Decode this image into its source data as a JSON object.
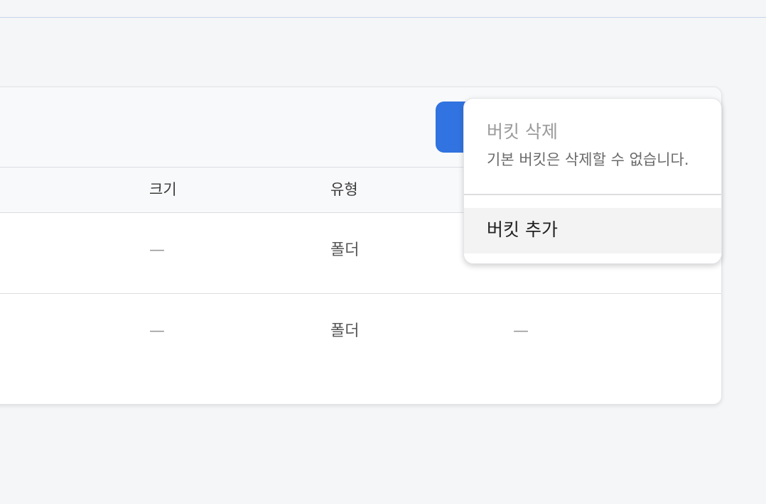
{
  "table": {
    "headers": {
      "size": "크기",
      "type": "유형"
    },
    "rows": [
      {
        "size": "—",
        "type": "폴더",
        "extra": ""
      },
      {
        "size": "—",
        "type": "폴더",
        "extra": "—"
      }
    ]
  },
  "menu": {
    "delete_bucket": {
      "label": "버킷 삭제",
      "hint": "기본 버킷은 삭제할 수 없습니다."
    },
    "add_bucket": {
      "label": "버킷 추가"
    }
  }
}
